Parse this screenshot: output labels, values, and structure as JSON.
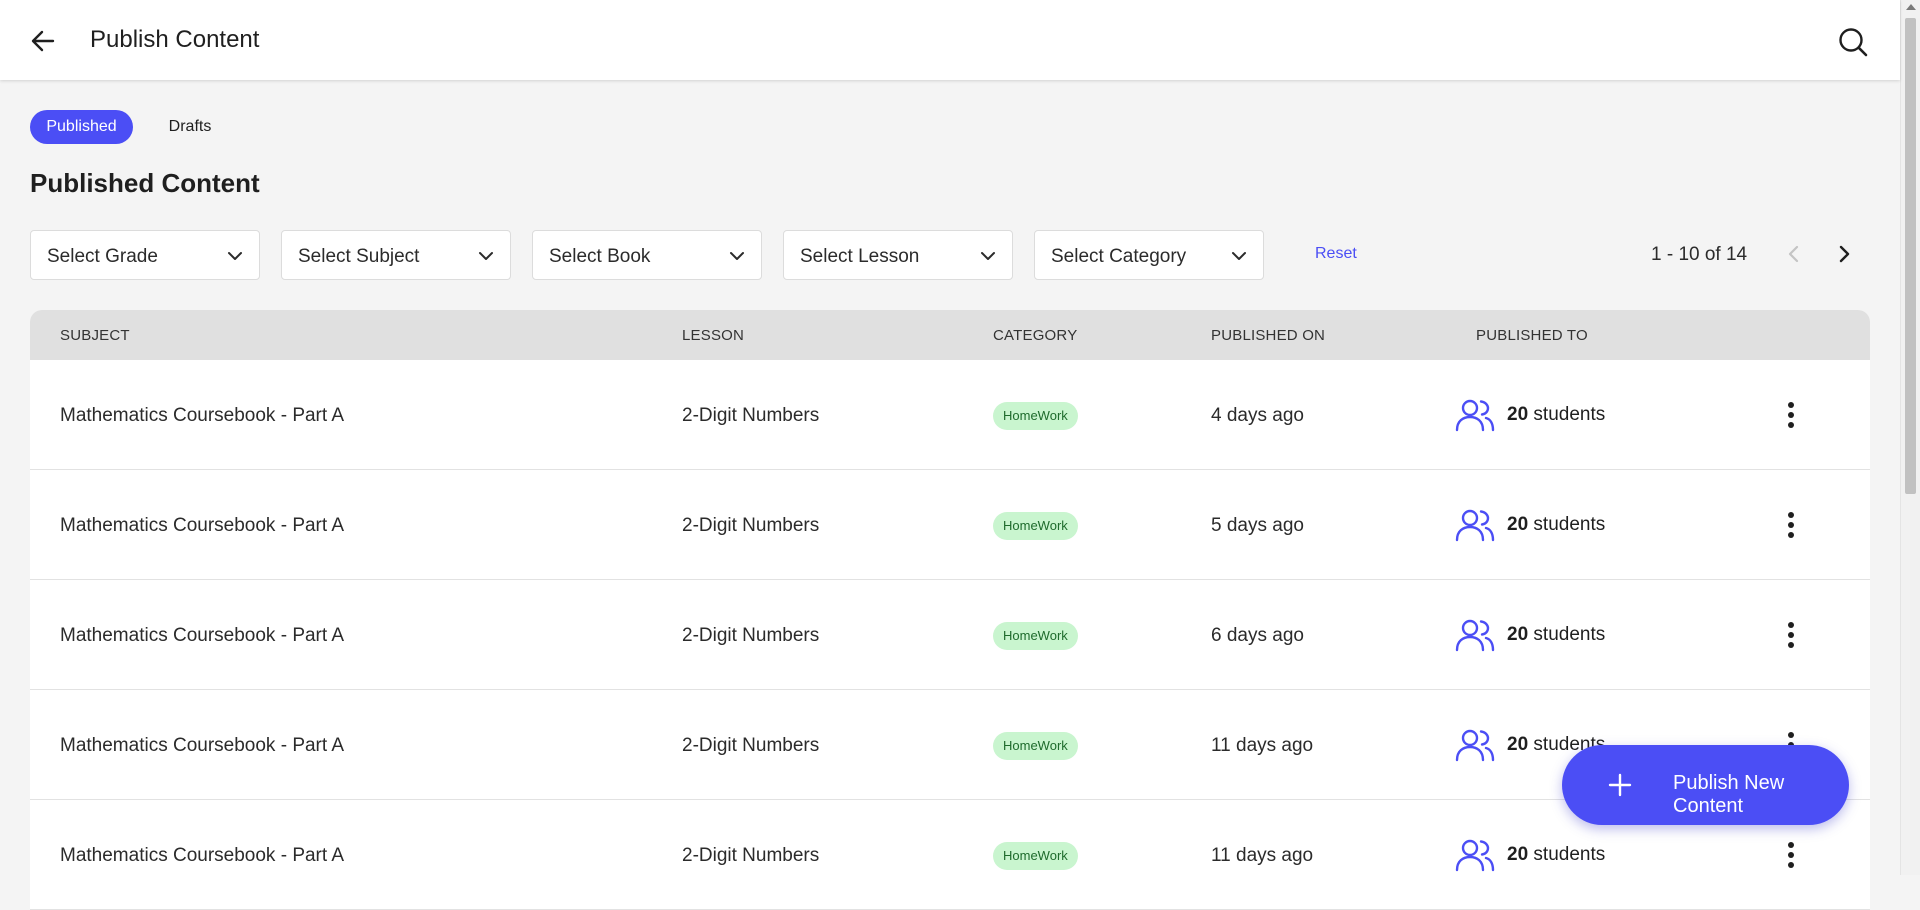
{
  "header": {
    "title": "Publish Content",
    "back_icon": "arrow-left-icon",
    "search_icon": "search-icon"
  },
  "tabs": [
    {
      "label": "Published",
      "active": true
    },
    {
      "label": "Drafts",
      "active": false
    }
  ],
  "section_title": "Published Content",
  "filters": [
    {
      "label": "Select Grade"
    },
    {
      "label": "Select Subject"
    },
    {
      "label": "Select Book"
    },
    {
      "label": "Select Lesson"
    },
    {
      "label": "Select Category"
    }
  ],
  "reset_label": "Reset",
  "pagination": {
    "text": "1 - 10 of 14"
  },
  "table": {
    "columns": [
      "SUBJECT",
      "LESSON",
      "CATEGORY",
      "PUBLISHED ON",
      "PUBLISHED TO"
    ],
    "rows": [
      {
        "subject": "Mathematics Coursebook - Part A",
        "lesson": "2-Digit Numbers",
        "category": "HomeWork",
        "published_on": "4 days ago",
        "count": "20",
        "unit": "students"
      },
      {
        "subject": "Mathematics Coursebook - Part A",
        "lesson": "2-Digit Numbers",
        "category": "HomeWork",
        "published_on": "5 days ago",
        "count": "20",
        "unit": "students"
      },
      {
        "subject": "Mathematics Coursebook - Part A",
        "lesson": "2-Digit Numbers",
        "category": "HomeWork",
        "published_on": "6 days ago",
        "count": "20",
        "unit": "students"
      },
      {
        "subject": "Mathematics Coursebook - Part A",
        "lesson": "2-Digit Numbers",
        "category": "HomeWork",
        "published_on": "11 days ago",
        "count": "20",
        "unit": "students"
      },
      {
        "subject": "Mathematics Coursebook - Part A",
        "lesson": "2-Digit Numbers",
        "category": "HomeWork",
        "published_on": "11 days ago",
        "count": "20",
        "unit": "students"
      }
    ]
  },
  "fab": {
    "label": "Publish New Content",
    "icon": "plus-icon"
  },
  "colors": {
    "accent": "#4b4ef5",
    "badge_bg": "#c9f5cf",
    "badge_text": "#1e6b2c"
  }
}
